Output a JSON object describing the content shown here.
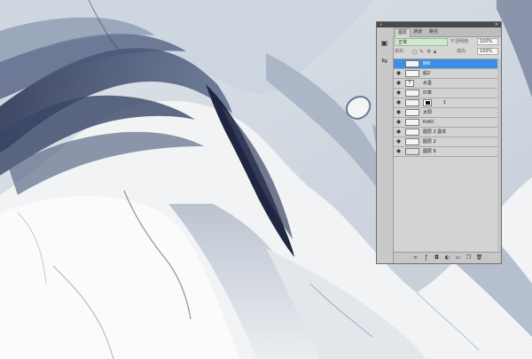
{
  "panel": {
    "tabs": [
      {
        "label": "图层",
        "active": true
      },
      {
        "label": "通道",
        "active": false
      },
      {
        "label": "路径",
        "active": false
      }
    ],
    "blend_mode": "正常",
    "opacity_label": "不透明度:",
    "opacity_value": "100%",
    "lock_label": "锁定:",
    "fill_label": "填充:",
    "fill_value": "100%",
    "layers": [
      {
        "name": "树6",
        "selected": true,
        "thumb": ""
      },
      {
        "name": "船2",
        "selected": false,
        "thumb": ""
      },
      {
        "name": "水墨",
        "selected": false,
        "thumb": "T"
      },
      {
        "name": "印章",
        "selected": false,
        "thumb": ""
      },
      {
        "name": "1",
        "selected": false,
        "thumb": "",
        "has_mask": true
      },
      {
        "name": "太阳",
        "selected": false,
        "thumb": ""
      },
      {
        "name": "RIAO",
        "selected": false,
        "thumb": ""
      },
      {
        "name": "图层 2 副本",
        "selected": false,
        "thumb": ""
      },
      {
        "name": "图层 2",
        "selected": false,
        "thumb": ""
      },
      {
        "name": "图层 6",
        "selected": false,
        "thumb": ""
      }
    ],
    "footer_icons": [
      "link-icon",
      "fx-icon",
      "mask-icon",
      "adjustment-icon",
      "folder-icon",
      "new-layer-icon",
      "trash-icon"
    ],
    "colors": {
      "selected": "#3d8ee6",
      "panel_bg": "#d6d6d6",
      "blend_bg": "#ccebcc"
    }
  },
  "canvas": {
    "colors": {
      "ink_dark": "#2c3553",
      "ink_mid": "#6f7d96",
      "ink_light": "#b9c3d1",
      "paper": "#eef1f4"
    }
  }
}
